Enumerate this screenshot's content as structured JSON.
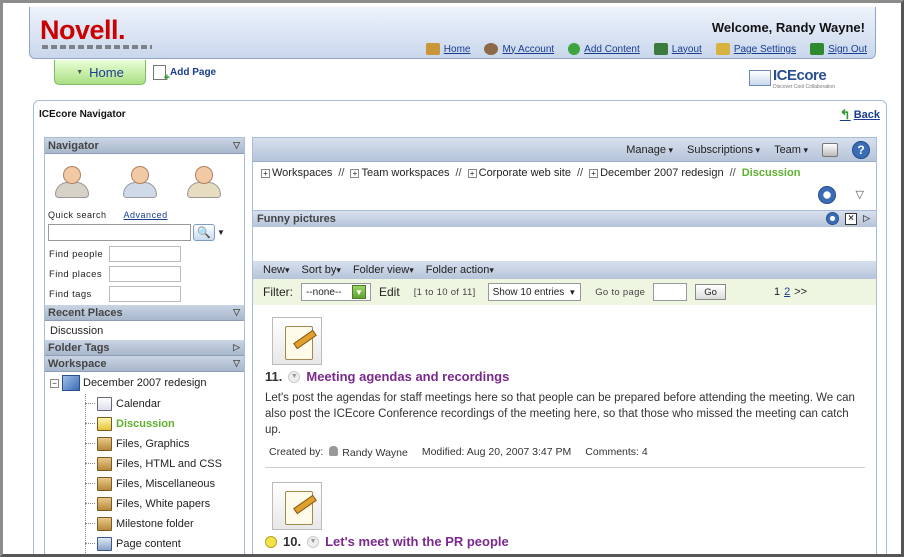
{
  "header": {
    "logo": "Novell.",
    "welcome": "Welcome, Randy Wayne!",
    "links": [
      {
        "label": "Home",
        "icon": "house-icon",
        "color": "#c9963a"
      },
      {
        "label": "My Account",
        "icon": "user-icon",
        "color": "#8c6a48"
      },
      {
        "label": "Add Content",
        "icon": "add-icon",
        "color": "#3fa33f"
      },
      {
        "label": "Layout",
        "icon": "layout-icon",
        "color": "#3d7a3d"
      },
      {
        "label": "Page Settings",
        "icon": "settings-icon",
        "color": "#d8b240"
      },
      {
        "label": "Sign Out",
        "icon": "signout-icon",
        "color": "#2f8a2f"
      }
    ]
  },
  "tabs": {
    "home": "Home",
    "add_page": "Add Page"
  },
  "brand": {
    "name": "ICEcore",
    "tagline": "Discover Cool Collaboration"
  },
  "navigator": {
    "title": "ICEcore Navigator",
    "back": "Back"
  },
  "sidebar": {
    "navigator_header": "Navigator",
    "quick_search": "Quick search",
    "advanced": "Advanced",
    "find_people": "Find people",
    "find_places": "Find places",
    "find_tags": "Find tags",
    "recent_header": "Recent Places",
    "recent_items": [
      "Discussion"
    ],
    "folder_tags_header": "Folder Tags",
    "workspace_header": "Workspace",
    "workspace_root": "December 2007 redesign",
    "tree": [
      {
        "label": "Calendar",
        "active": false
      },
      {
        "label": "Discussion",
        "active": true
      },
      {
        "label": "Files, Graphics",
        "active": false
      },
      {
        "label": "Files, HTML and CSS",
        "active": false
      },
      {
        "label": "Files, Miscellaneous",
        "active": false
      },
      {
        "label": "Files, White papers",
        "active": false
      },
      {
        "label": "Milestone folder",
        "active": false
      },
      {
        "label": "Page content",
        "active": false
      }
    ]
  },
  "toolbar": {
    "manage": "Manage",
    "subscriptions": "Subscriptions",
    "team": "Team"
  },
  "breadcrumbs": {
    "items": [
      "Workspaces",
      "Team workspaces",
      "Corporate web site",
      "December 2007 redesign"
    ],
    "separator": "//",
    "current": "Discussion"
  },
  "accessory": {
    "title": "Funny pictures"
  },
  "folderbar": {
    "new": "New",
    "sort": "Sort by",
    "view": "Folder view",
    "action": "Folder action"
  },
  "filter": {
    "label": "Filter:",
    "value": "--none--",
    "edit": "Edit",
    "range": "[1 to 10 of 11]",
    "show": "Show 10 entries",
    "goto": "Go to page",
    "go": "Go",
    "page1": "1",
    "page2": "2",
    "next": ">>"
  },
  "entries": [
    {
      "num": "11.",
      "title": "Meeting agendas and recordings",
      "desc": "Let's post the agendas for staff meetings here so that people can be prepared before attending the meeting. We can also post the ICEcore Conference recordings of the meeting here, so that those who missed the meeting can catch up.",
      "created_label": "Created by:",
      "author": "Randy Wayne",
      "modified": "Modified: Aug 20, 2007 3:47 PM",
      "comments": "Comments: 4"
    },
    {
      "num": "10.",
      "title": "Let's meet with the PR people"
    }
  ]
}
